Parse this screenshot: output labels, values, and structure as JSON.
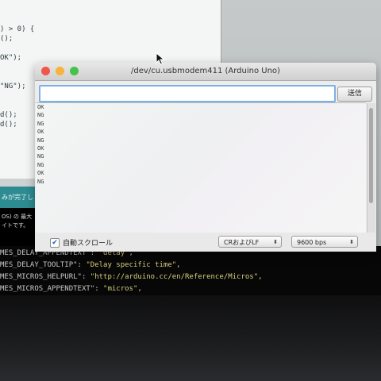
{
  "editor": {
    "code_lines": [
      ") > 0) {",
      "();",
      "",
      "OK\");",
      "",
      "",
      "\"NG\");",
      "",
      "",
      "d();",
      "d();"
    ]
  },
  "ide": {
    "status_bar_text": "みが完了し",
    "console_lines": [
      "OS) の 最大",
      "イトです。"
    ],
    "bottom_code": [
      {
        "key": "MES_DELAY_APPENDTEXT\": ",
        "value": "\"delay\","
      },
      {
        "key": "MES_DELAY_TOOLTIP\": ",
        "value": "\"Delay specific time\","
      },
      {
        "key": "MES_MICROS_HELPURL\": ",
        "value": "\"http://arduino.cc/en/Reference/Micros\","
      },
      {
        "key": "MES_MICROS_APPENDTEXT\": ",
        "value": "\"micros\","
      }
    ]
  },
  "serial_monitor": {
    "title": "/dev/cu.usbmodem411 (Arduino Uno)",
    "input_value": "",
    "send_label": "送信",
    "output_lines": [
      "OK",
      "NG",
      "NG",
      "OK",
      "NG",
      "OK",
      "NG",
      "NG",
      "OK",
      "NG"
    ],
    "autoscroll_label": "自動スクロール",
    "autoscroll_checked": true,
    "line_ending": "CRおよびLF",
    "baud_rate": "9600 bps"
  },
  "icons": {
    "checkmark": "✔",
    "select_arrows": "⬍"
  },
  "colors": {
    "close": "#f1564c",
    "minimize": "#f6b43a",
    "zoom": "#45c249",
    "input_focus": "#7cb1e6",
    "status_bar": "#2d8c92"
  }
}
